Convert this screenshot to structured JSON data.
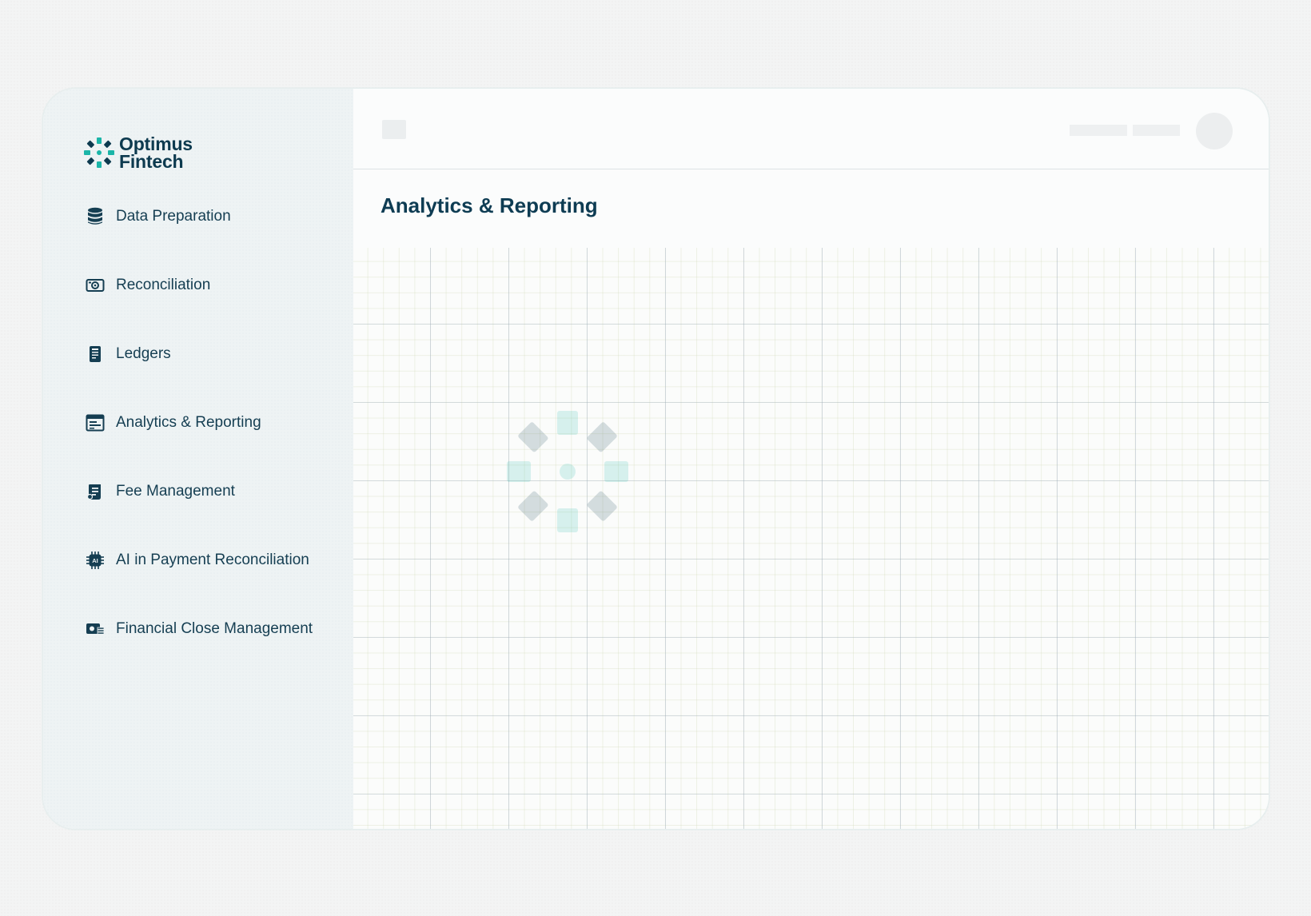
{
  "brand": {
    "line1": "Optimus",
    "line2": "Fintech",
    "colors": {
      "primary": "#0d3a4f",
      "accent": "#1bb5a8"
    }
  },
  "sidebar": {
    "items": [
      {
        "label": "Data Preparation",
        "icon": "database-icon"
      },
      {
        "label": "Reconciliation",
        "icon": "reconciliation-icon"
      },
      {
        "label": "Ledgers",
        "icon": "ledger-book-icon"
      },
      {
        "label": "Analytics & Reporting",
        "icon": "report-window-icon"
      },
      {
        "label": "Fee Management",
        "icon": "fee-document-icon"
      },
      {
        "label": "AI in Payment Reconciliation",
        "icon": "ai-chip-icon"
      },
      {
        "label": "Financial Close Management",
        "icon": "financial-close-icon"
      }
    ]
  },
  "main": {
    "title": "Analytics & Reporting"
  }
}
